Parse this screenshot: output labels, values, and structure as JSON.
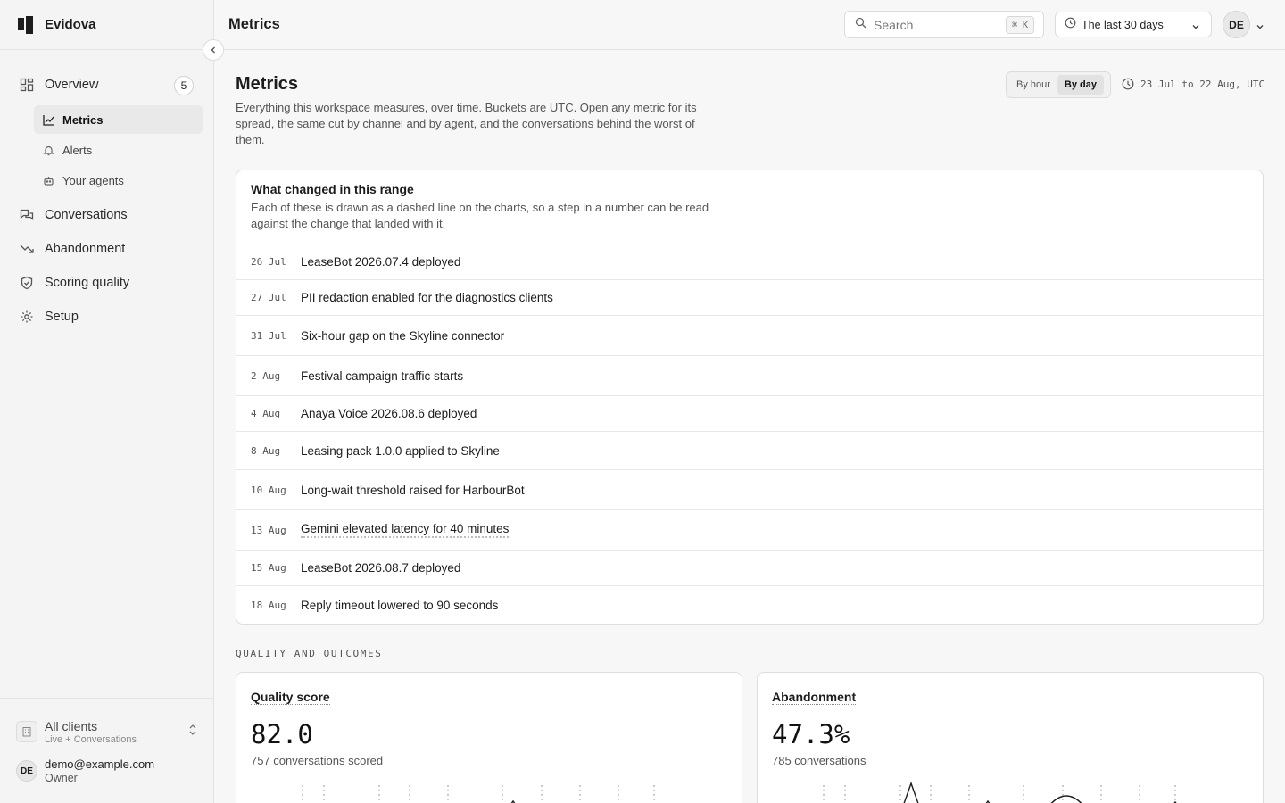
{
  "brand": {
    "name": "Evidova"
  },
  "sidebar": {
    "items": [
      {
        "label": "Overview",
        "badge": "5"
      },
      {
        "label": "Conversations"
      },
      {
        "label": "Abandonment"
      },
      {
        "label": "Scoring quality"
      },
      {
        "label": "Setup"
      }
    ],
    "subitems": [
      {
        "label": "Metrics",
        "active": true
      },
      {
        "label": "Alerts"
      },
      {
        "label": "Your agents"
      }
    ],
    "client": {
      "name": "All clients",
      "sub": "Live + Conversations"
    },
    "user": {
      "initials": "DE",
      "email": "demo@example.com",
      "role": "Owner"
    }
  },
  "topbar": {
    "title": "Metrics",
    "search_placeholder": "Search",
    "shortcut": "⌘ K",
    "range_label": "The last 30 days",
    "avatar_initials": "DE"
  },
  "page": {
    "title": "Metrics",
    "description": "Everything this workspace measures, over time. Buckets are UTC. Open any metric for its spread, the same cut by channel and by agent, and the conversations behind the worst of them.",
    "granularity": {
      "options": [
        "By hour",
        "By day"
      ],
      "selected": "By day"
    },
    "range_text": "23 Jul to 22 Aug, UTC"
  },
  "changes": {
    "title": "What changed in this range",
    "description": "Each of these is drawn as a dashed line on the charts, so a step in a number can be read against the change that landed with it.",
    "items": [
      {
        "date": "26 Jul",
        "label": "LeaseBot 2026.07.4 deployed"
      },
      {
        "date": "27 Jul",
        "label": "PII redaction enabled for the diagnostics clients"
      },
      {
        "date": "31 Jul",
        "label": "Six-hour gap on the Skyline connector"
      },
      {
        "date": "2 Aug",
        "label": "Festival campaign traffic starts"
      },
      {
        "date": "4 Aug",
        "label": "Anaya Voice 2026.08.6 deployed"
      },
      {
        "date": "8 Aug",
        "label": "Leasing pack 1.0.0 applied to Skyline"
      },
      {
        "date": "10 Aug",
        "label": "Long-wait threshold raised for HarbourBot"
      },
      {
        "date": "13 Aug",
        "label": "Gemini elevated latency for 40 minutes"
      },
      {
        "date": "15 Aug",
        "label": "LeaseBot 2026.08.7 deployed"
      },
      {
        "date": "18 Aug",
        "label": "Reply timeout lowered to 90 seconds"
      }
    ]
  },
  "section": {
    "label": "QUALITY AND OUTCOMES"
  },
  "metrics": {
    "quality": {
      "title": "Quality score",
      "value": "82.0",
      "sub": "757 conversations scored"
    },
    "abandonment": {
      "title": "Abandonment",
      "value": "47.3%",
      "sub": "785 conversations"
    }
  },
  "colors": {
    "accent": "#1c1c1c",
    "border": "#dedede",
    "muted": "#555555"
  }
}
